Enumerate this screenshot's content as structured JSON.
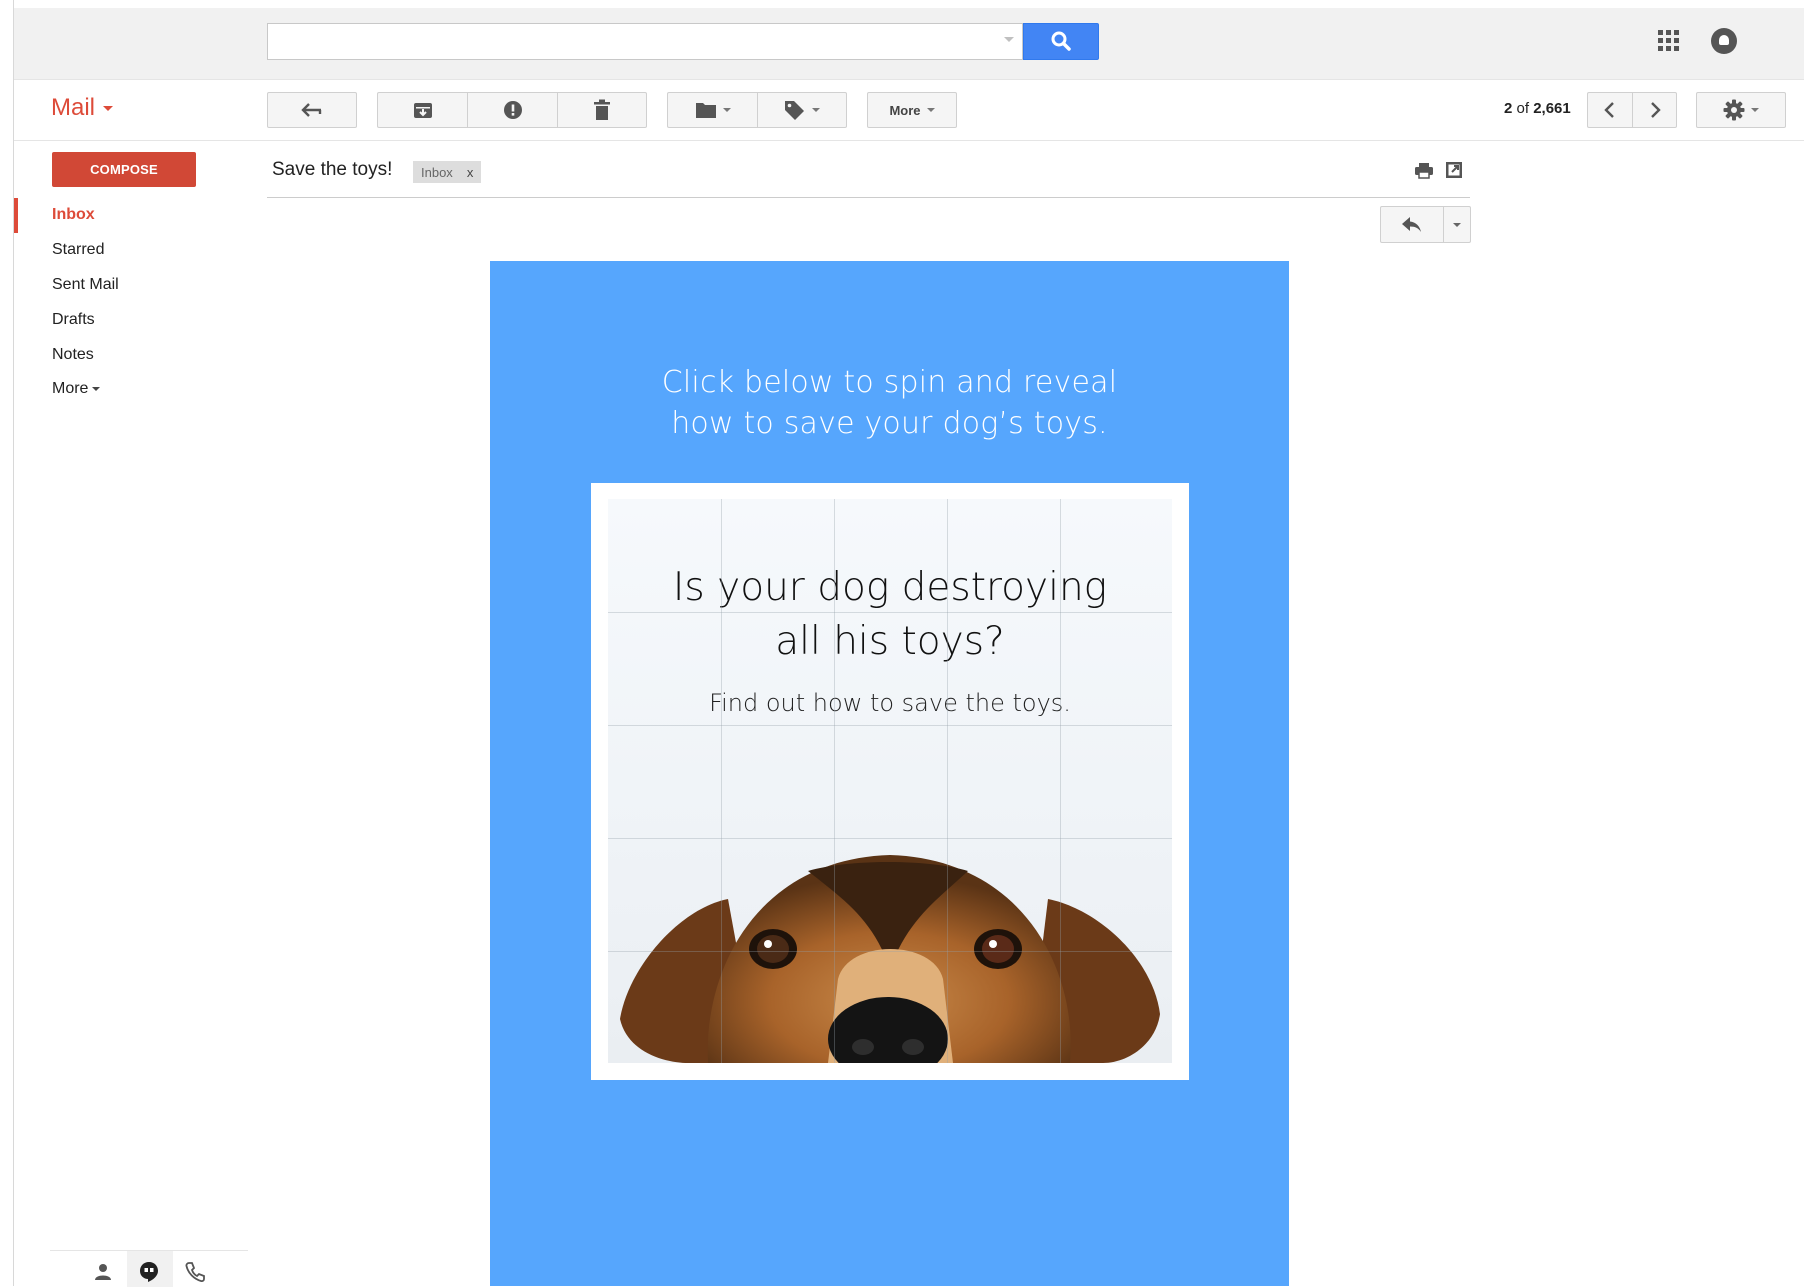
{
  "app": {
    "title": "Mail"
  },
  "search": {
    "placeholder": ""
  },
  "toolbar": {
    "more_label": "More",
    "paging_current": "2",
    "paging_of": "of",
    "paging_total": "2,661"
  },
  "sidebar": {
    "compose_label": "COMPOSE",
    "items": [
      {
        "label": "Inbox",
        "active": true
      },
      {
        "label": "Starred"
      },
      {
        "label": "Sent Mail"
      },
      {
        "label": "Drafts"
      },
      {
        "label": "Notes"
      },
      {
        "label": "More"
      }
    ]
  },
  "message": {
    "subject": "Save the toys!",
    "label_chip": "Inbox",
    "label_remove": "x"
  },
  "email": {
    "intro_line1": "Click below to spin and reveal",
    "intro_line2": "how to save your dog’s toys.",
    "headline_line1": "Is your dog destroying",
    "headline_line2": "all his toys?",
    "subline": "Find out how to save the toys.",
    "background_color": "#56a6fd"
  },
  "colors": {
    "accent_red": "#dd4b39",
    "compose_red": "#d14836",
    "search_blue": "#4285f4"
  },
  "icons": {
    "search": "search-icon",
    "apps": "apps-grid-icon",
    "notifications": "notifications-icon",
    "back": "back-arrow-icon",
    "archive": "archive-icon",
    "spam": "report-spam-icon",
    "delete": "trash-icon",
    "move": "folder-icon",
    "labels": "label-tag-icon",
    "prev": "chevron-left-icon",
    "next": "chevron-right-icon",
    "settings": "gear-icon",
    "print": "print-icon",
    "new_window": "new-window-icon",
    "reply": "reply-icon",
    "contacts": "person-icon",
    "hangouts": "hangouts-icon",
    "phone": "phone-icon"
  }
}
